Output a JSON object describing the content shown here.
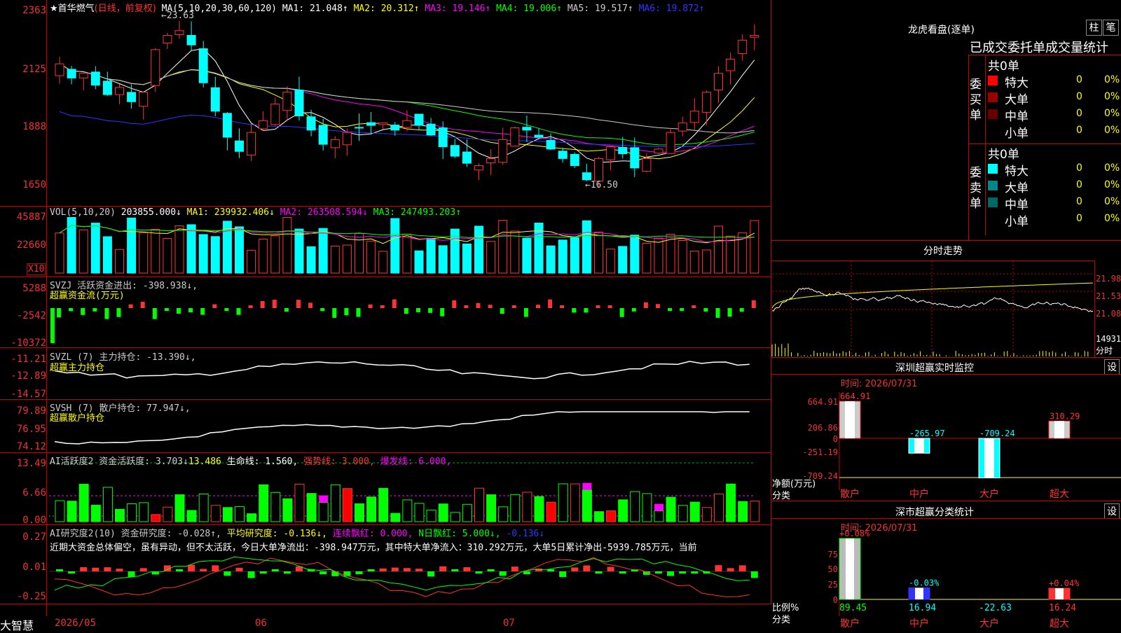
{
  "main": {
    "title": "★首华燃气",
    "mode": "(日线，前复权)",
    "ma_label": "MA(5,10,20,30,60,120)",
    "ma": [
      {
        "label": "MA1: 21.048↑",
        "color": "#ffffff"
      },
      {
        "label": "MA2: 20.312↑",
        "color": "#ffff00"
      },
      {
        "label": "MA3: 19.146↑",
        "color": "#ff00ff"
      },
      {
        "label": "MA4: 19.006↑",
        "color": "#00ff00"
      },
      {
        "label": "MA5: 19.517↑",
        "color": "#cccccc"
      },
      {
        "label": "MA6: 19.872↑",
        "color": "#0000ff"
      }
    ],
    "yticks": [
      "2363",
      "2125",
      "1888",
      "1650"
    ],
    "high_mark": "←23.63",
    "low_mark": "←16.50"
  },
  "vol": {
    "title": "VOL(5,10,20)",
    "value": "203855.000↓",
    "ma1": "MA1: 239932.406↓",
    "ma2": "MA2: 263508.594↓",
    "ma3": "MA3: 247493.203↑",
    "yticks": [
      "45887",
      "22660"
    ],
    "unit": "X10"
  },
  "svzj": {
    "title": "SVZJ  活跃资金进出: -398.938↓,",
    "sub": "超赢资金流(万元)",
    "yticks": [
      "5288",
      "-2542",
      "-10372"
    ]
  },
  "svzl": {
    "title": "SVZL (7) 主力持仓: -13.390↓,",
    "sub": "超赢主力持仓",
    "yticks": [
      "-11.21",
      "-12.89",
      "-14.57"
    ]
  },
  "svsh": {
    "title": "SVSH (7) 散户持仓: 77.947↓,",
    "sub": "超赢散户持仓",
    "yticks": [
      "79.89",
      "76.95",
      "74.12"
    ]
  },
  "ai_active": {
    "title": "AI活跃度2 资金活跃度: 3.703↓",
    "v2": "13.486",
    "v3": "生命线: 1.560,",
    "v4": "强势线: 3.000,",
    "v5": "爆发线: 6.000,",
    "yticks": [
      "13.49",
      "6.66",
      "0.00"
    ]
  },
  "ai_research": {
    "title": "AI研究度2(10) 资金研究度: -0.028↑,",
    "avg": "平均研究度: -0.136↓,",
    "cont": "连续飘红: 0.000,",
    "nday": "N日飘红: 5.000↓,",
    "last": "-0.136↓",
    "desc": "近期大资金总体偏空，虽有异动，但不太活跃，今日大单净流出：-398.947万元，其中特大单净流入：310.292万元，大单5日累计净出-5939.785万元，当前",
    "yticks": [
      "0.27",
      "0.01",
      "-0.25"
    ]
  },
  "footer": {
    "brand": "大智慧",
    "dates": [
      "2026/05",
      "06",
      "07"
    ]
  },
  "dragon": {
    "title": "龙虎看盘(逐单)",
    "btn1": "柱",
    "btn2": "笔",
    "tabs": "已成交委托单成交量统计",
    "buy_label": "委买单",
    "sell_label": "委卖单",
    "buy_total": "共0单",
    "sell_total": "共0单",
    "buy_rows": [
      {
        "name": "特大",
        "count": "0",
        "pct": "0%",
        "color": "#ff0000"
      },
      {
        "name": "大单",
        "count": "0",
        "pct": "0%",
        "color": "#990000"
      },
      {
        "name": "中单",
        "count": "0",
        "pct": "0%",
        "color": "#660000"
      },
      {
        "name": "小单",
        "count": "0",
        "pct": "0%",
        "color": "#000000"
      }
    ],
    "sell_rows": [
      {
        "name": "特大",
        "count": "0",
        "pct": "0%",
        "color": "#00ffff"
      },
      {
        "name": "大单",
        "count": "0",
        "pct": "0%",
        "color": "#008888"
      },
      {
        "name": "中单",
        "count": "0",
        "pct": "0%",
        "color": "#006666"
      },
      {
        "name": "小单",
        "count": "0",
        "pct": "0%",
        "color": "#000000"
      }
    ]
  },
  "intraday": {
    "title": "分时走势",
    "yticks": [
      "21.98",
      "21.53",
      "21.08"
    ],
    "vol_tick": "14931",
    "vol_unit": "分时"
  },
  "sz_monitor": {
    "title": "深圳超赢实时监控",
    "btn": "设",
    "time": "时间: 2026/07/31",
    "yticks": [
      "664.91",
      "206.86",
      "0",
      "-251.19",
      "-709.24"
    ],
    "axis_label": "净额(万元)",
    "cat_label": "分类",
    "bars": [
      {
        "cat": "散户",
        "value": 664.91,
        "label": "664.91"
      },
      {
        "cat": "中户",
        "value": -265.97,
        "label": "-265.97"
      },
      {
        "cat": "大户",
        "value": -709.24,
        "label": "-709.24"
      },
      {
        "cat": "超大",
        "value": 310.29,
        "label": "310.29"
      }
    ]
  },
  "sz_class": {
    "title": "深市超赢分类统计",
    "btn": "设",
    "time": "时间: 2026/07/31",
    "yticks": [
      "75",
      "50",
      "25",
      "0"
    ],
    "axis_label": "比例%",
    "cat_label": "分类",
    "bars": [
      {
        "cat": "散户",
        "pct": 89.45,
        "delta": "+0.08%",
        "val": "89.45"
      },
      {
        "cat": "中户",
        "pct": 16.94,
        "delta": "-0.03%",
        "val": "16.94"
      },
      {
        "cat": "大户",
        "pct": -22.63,
        "delta": "",
        "val": "-22.63"
      },
      {
        "cat": "超大",
        "pct": 16.24,
        "delta": "+0.04%",
        "val": "16.24"
      }
    ]
  }
}
